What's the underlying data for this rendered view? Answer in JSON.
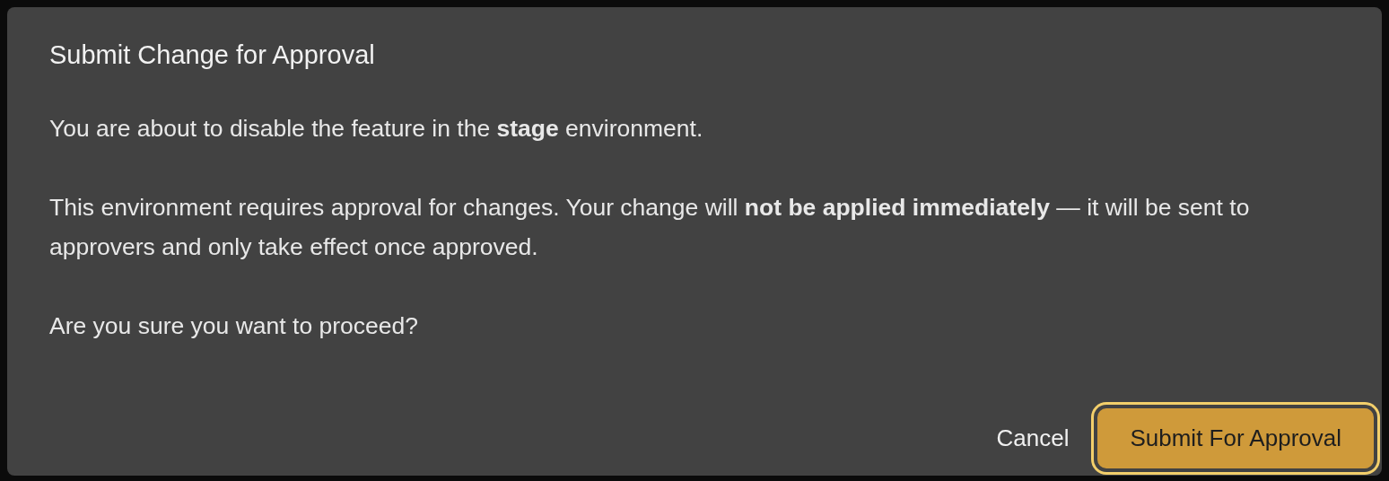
{
  "dialog": {
    "title": "Submit Change for Approval",
    "paragraphs": [
      "You are about to disable the feature in the **stage** environment.",
      "This environment requires approval for changes. Your change will **not be applied immediately** — it will be sent to approvers and only take effect once approved.",
      "Are you sure you want to proceed?"
    ],
    "buttons": [
      {
        "label": "Cancel",
        "kind": "link",
        "focused": false
      },
      {
        "label": "Submit For Approval",
        "kind": "primary",
        "focused": true
      }
    ]
  }
}
